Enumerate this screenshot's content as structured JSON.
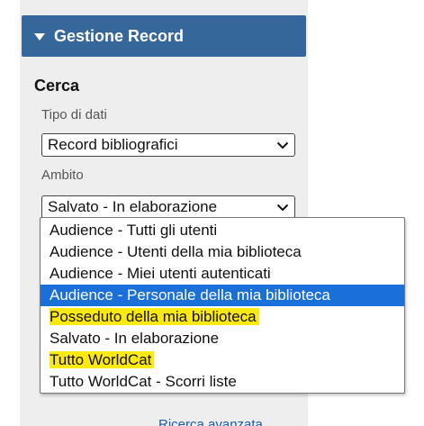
{
  "panel": {
    "title": "Gestione Record",
    "section_title": "Cerca",
    "data_type": {
      "label": "Tipo di dati",
      "value": "Record bibliografici"
    },
    "scope": {
      "label": "Ambito",
      "value": "Salvato - In elaborazione"
    },
    "footer_link": "Ricerca avanzata"
  },
  "dropdown": {
    "options": [
      {
        "label": "Audience - Tutti gli utenti",
        "selected": false,
        "highlighted": false
      },
      {
        "label": "Audience - Utenti della mia biblioteca",
        "selected": false,
        "highlighted": false
      },
      {
        "label": "Audience - Miei utenti autenticati",
        "selected": false,
        "highlighted": false
      },
      {
        "label": "Audience - Personale della mia biblioteca",
        "selected": true,
        "highlighted": false
      },
      {
        "label": "Posseduto della mia biblioteca",
        "selected": false,
        "highlighted": true
      },
      {
        "label": "Salvato - In elaborazione",
        "selected": false,
        "highlighted": false
      },
      {
        "label": "Tutto WorldCat",
        "selected": false,
        "highlighted": true
      },
      {
        "label": "Tutto WorldCat - Scorri liste",
        "selected": false,
        "highlighted": false
      }
    ]
  },
  "colors": {
    "header_bg": "#36679b",
    "selected_bg": "#1a6fd8",
    "highlight": "#fde910",
    "panel_bg": "#eeeeee"
  },
  "icons": {
    "header_toggle": "caret-down-icon",
    "select_arrow": "chevron-down-icon"
  }
}
